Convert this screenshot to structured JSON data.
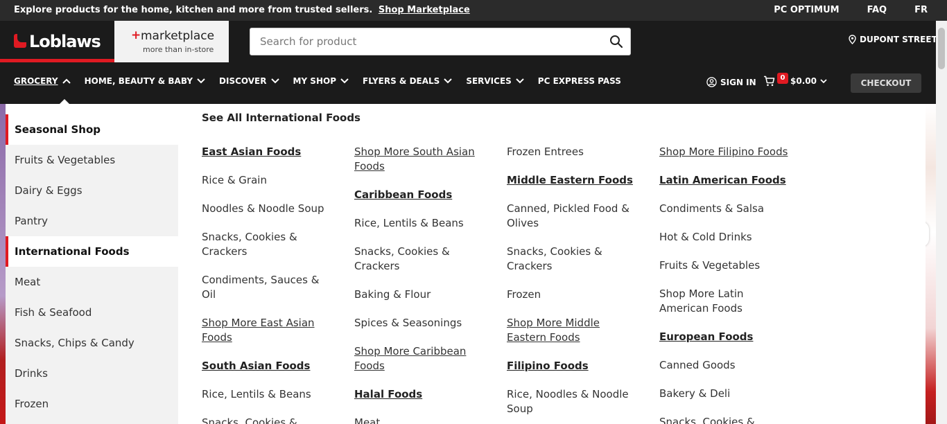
{
  "promo": {
    "text": "Explore products for the home, kitchen and more from trusted sellers.",
    "link": "Shop Marketplace",
    "right_links": [
      "PC OPTIMUM",
      "FAQ",
      "FR"
    ]
  },
  "header": {
    "logo": "Loblaws",
    "marketplace_title": "marketplace",
    "marketplace_sub": "more than in-store",
    "search_placeholder": "Search for product",
    "store": "DUPONT STREET"
  },
  "nav": {
    "items": [
      "GROCERY",
      "HOME, BEAUTY & BABY",
      "DISCOVER",
      "MY SHOP",
      "FLYERS & DEALS",
      "SERVICES",
      "PC EXPRESS PASS"
    ],
    "sign_in": "SIGN IN",
    "cart_count": "0",
    "cart_total": "$0.00",
    "checkout": "CHECKOUT"
  },
  "sidebar": {
    "items": [
      "Seasonal Shop",
      "Fruits & Vegetables",
      "Dairy & Eggs",
      "Pantry",
      "International Foods",
      "Meat",
      "Fish & Seafood",
      "Snacks, Chips & Candy",
      "Drinks",
      "Frozen"
    ]
  },
  "panel": {
    "see_all": "See All International Foods",
    "columns": [
      [
        {
          "text": "East Asian Foods",
          "style": "heading"
        },
        {
          "text": "Rice & Grain",
          "style": "plain"
        },
        {
          "text": "Noodles & Noodle Soup",
          "style": "plain"
        },
        {
          "text": "Snacks, Cookies & Crackers",
          "style": "plain"
        },
        {
          "text": "Condiments, Sauces & Oil",
          "style": "plain"
        },
        {
          "text": "Shop More East Asian Foods",
          "style": "underline"
        },
        {
          "text": "South Asian Foods",
          "style": "heading"
        },
        {
          "text": "Rice, Lentils & Beans",
          "style": "plain"
        },
        {
          "text": "Snacks, Cookies &",
          "style": "plain"
        }
      ],
      [
        {
          "text": "Shop More South Asian Foods",
          "style": "underline"
        },
        {
          "text": "Caribbean Foods",
          "style": "heading"
        },
        {
          "text": "Rice, Lentils & Beans",
          "style": "plain"
        },
        {
          "text": "Snacks, Cookies & Crackers",
          "style": "plain"
        },
        {
          "text": "Baking & Flour",
          "style": "plain"
        },
        {
          "text": "Spices & Seasonings",
          "style": "plain"
        },
        {
          "text": "Shop More Caribbean Foods",
          "style": "underline"
        },
        {
          "text": "Halal Foods",
          "style": "heading"
        },
        {
          "text": "Meat",
          "style": "plain"
        }
      ],
      [
        {
          "text": "Frozen Entrees",
          "style": "plain"
        },
        {
          "text": "Middle Eastern Foods",
          "style": "heading"
        },
        {
          "text": "Canned, Pickled Food & Olives",
          "style": "plain"
        },
        {
          "text": "Snacks, Cookies & Crackers",
          "style": "plain"
        },
        {
          "text": "Frozen",
          "style": "plain"
        },
        {
          "text": "Shop More Middle Eastern Foods",
          "style": "underline"
        },
        {
          "text": "Filipino Foods",
          "style": "heading"
        },
        {
          "text": "Rice, Noodles & Noodle Soup",
          "style": "plain"
        }
      ],
      [
        {
          "text": "Shop More Filipino Foods",
          "style": "underline"
        },
        {
          "text": "Latin American Foods",
          "style": "heading"
        },
        {
          "text": "Condiments & Salsa",
          "style": "plain"
        },
        {
          "text": "Hot & Cold Drinks",
          "style": "plain"
        },
        {
          "text": "Fruits & Vegetables",
          "style": "plain"
        },
        {
          "text": "Shop More Latin American Foods",
          "style": "plain"
        },
        {
          "text": "European Foods",
          "style": "heading"
        },
        {
          "text": "Canned Goods",
          "style": "plain"
        },
        {
          "text": "Bakery & Deli",
          "style": "plain"
        },
        {
          "text": "Snacks, Cookies &",
          "style": "plain"
        }
      ]
    ]
  },
  "colors": {
    "brand_red": "#e01a22",
    "dark_bg": "#1b1b1b"
  }
}
